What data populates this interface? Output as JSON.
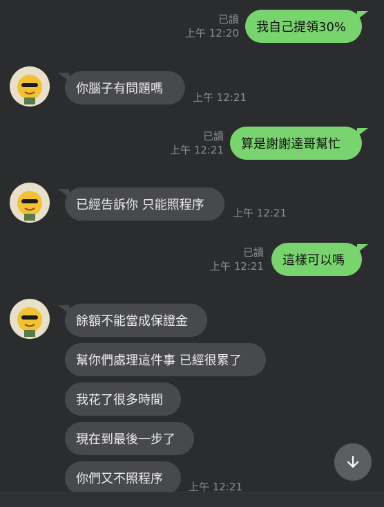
{
  "read_label": "已讀",
  "messages": [
    {
      "text": "我自己提領30%",
      "time": "上午 12:20",
      "read": "已讀"
    },
    {
      "text": "你腦子有問題嗎",
      "time": "上午 12:21"
    },
    {
      "text": "算是謝謝達哥幫忙",
      "time": "上午 12:21",
      "read": "已讀"
    },
    {
      "text": "已經告訴你 只能照程序",
      "time": "上午 12:21"
    },
    {
      "text": "這樣可以嗎",
      "time": "上午 12:21",
      "read": "已讀"
    },
    {
      "text": "餘額不能當成保證金"
    },
    {
      "text": "幫你們處理這件事 已經很累了"
    },
    {
      "text": "我花了很多時間"
    },
    {
      "text": "現在到最後一步了"
    },
    {
      "text": "你們又不照程序",
      "time": "上午 12:21"
    }
  ],
  "colors": {
    "background": "#2b2c2e",
    "outgoing_bubble": "#79d46f",
    "incoming_bubble": "#48494c",
    "meta_text": "#8d8e90"
  },
  "icons": {
    "avatar": "cartoon-character-avatar",
    "scroll_down": "arrow-down-icon"
  }
}
